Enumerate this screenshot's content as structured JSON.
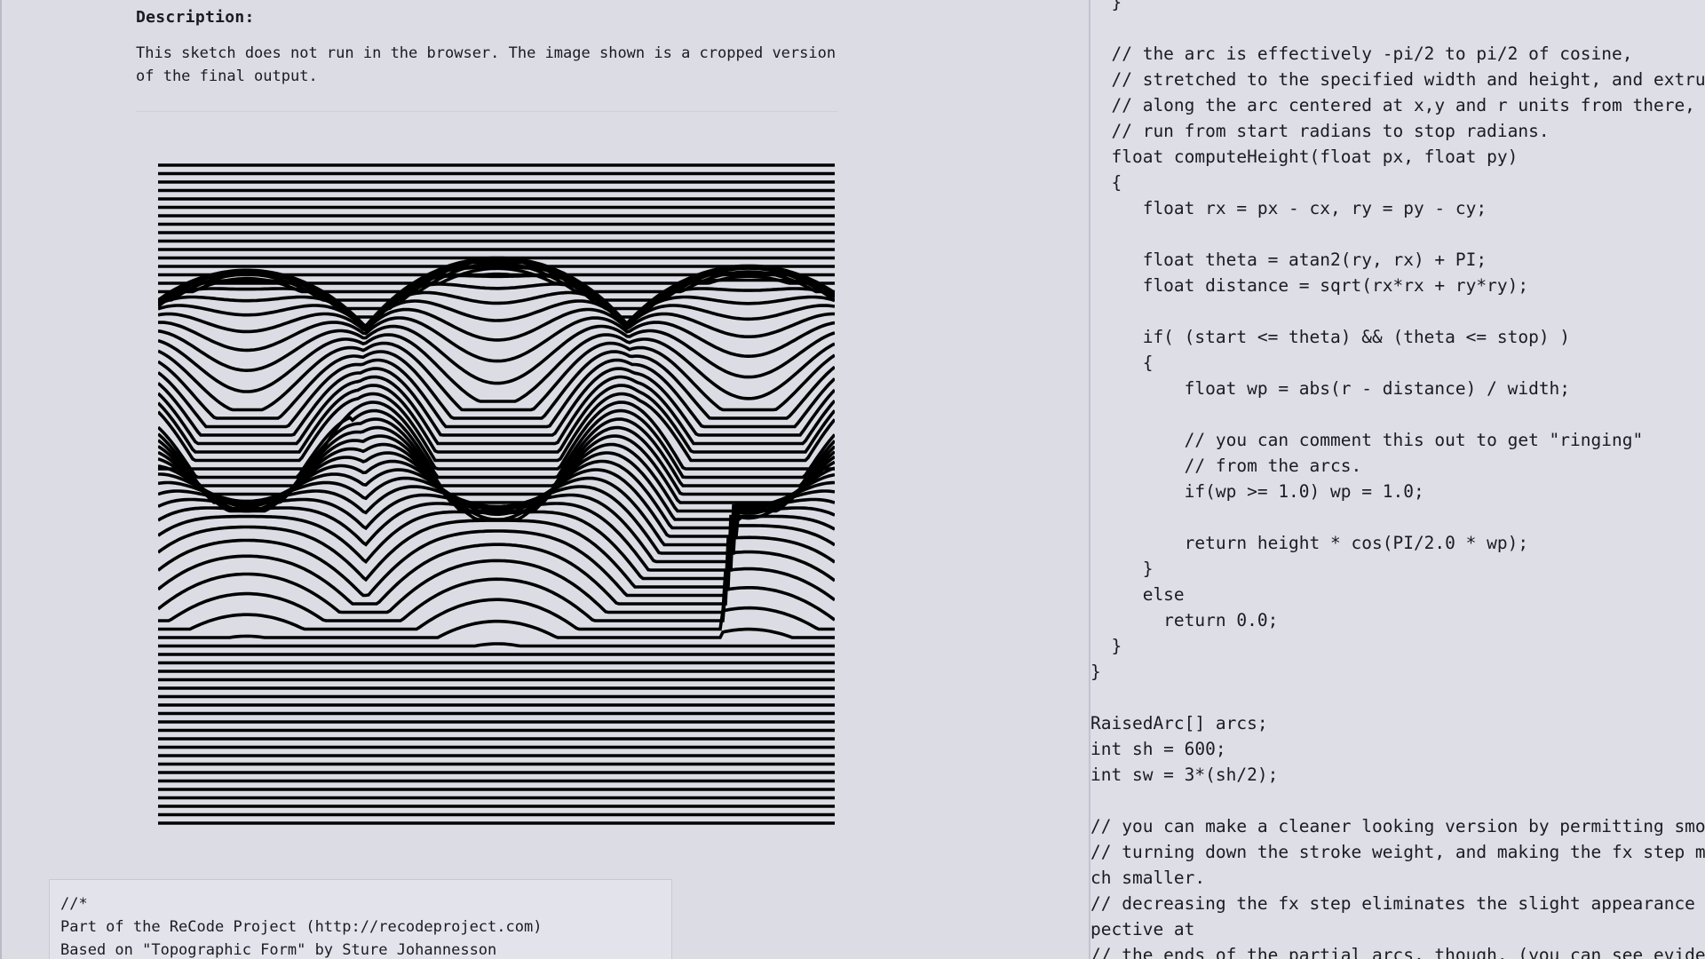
{
  "description": {
    "title": "Description:",
    "lines": [
      "This sketch does not run in the browser. The image shown is a cropped version",
      "of the final output."
    ]
  },
  "sketch": {
    "image": "topographic-form-sketch",
    "line_color": "#000000",
    "background": "#dbdce4"
  },
  "comment": {
    "lines": [
      "//*",
      "Part of the ReCode Project (http://recodeproject.com)",
      "Based on \"Topographic Form\" by Sture Johannesson"
    ]
  },
  "code": {
    "lines": [
      "  }",
      "",
      "  // the arc is effectively -pi/2 to pi/2 of cosine,",
      "  // stretched to the specified width and height, and extru",
      "  // along the arc centered at x,y and r units from there,",
      "  // run from start radians to stop radians.",
      "  float computeHeight(float px, float py)",
      "  {",
      "     float rx = px - cx, ry = py - cy;",
      "",
      "     float theta = atan2(ry, rx) + PI;",
      "     float distance = sqrt(rx*rx + ry*ry);",
      "",
      "     if( (start <= theta) && (theta <= stop) )",
      "     {",
      "         float wp = abs(r - distance) / width;",
      "",
      "         // you can comment this out to get \"ringing\"",
      "         // from the arcs.",
      "         if(wp >= 1.0) wp = 1.0;",
      "",
      "         return height * cos(PI/2.0 * wp);",
      "     }",
      "     else",
      "       return 0.0;",
      "  }",
      "}",
      "",
      "RaisedArc[] arcs;",
      "int sh = 600;",
      "int sw = 3*(sh/2);",
      "",
      "// you can make a cleaner looking version by permitting smo",
      "// turning down the stroke weight, and making the fx step m",
      "ch smaller.",
      "// decreasing the fx step eliminates the slight appearance",
      "pective at",
      "// the ends of the partial arcs, though. (you can see evide"
    ]
  }
}
